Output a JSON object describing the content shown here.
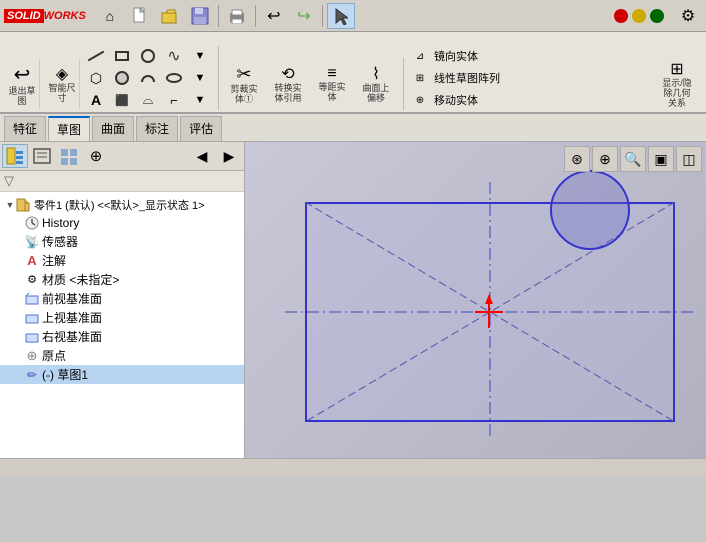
{
  "app": {
    "title": "SOLIDWORKS",
    "logo_solid": "SOLID",
    "logo_works": "WORKS"
  },
  "topbar": {
    "buttons": [
      "home",
      "new",
      "open",
      "save",
      "print",
      "undo",
      "redo",
      "cursor"
    ]
  },
  "ribbon": {
    "rows": [
      {
        "groups": [
          {
            "name": "exit-sketch",
            "buttons": [
              {
                "label": "退出草\n图",
                "icon": "↩",
                "large": true
              }
            ]
          },
          {
            "name": "smart-dim",
            "buttons": [
              {
                "label": "智能尺\n寸",
                "icon": "◈",
                "large": true
              }
            ]
          },
          {
            "name": "lines",
            "buttons": [
              {
                "label": "",
                "icon": "╲",
                "row": 0
              },
              {
                "label": "",
                "icon": "⌒",
                "row": 0
              },
              {
                "label": "",
                "icon": "∿",
                "row": 0
              },
              {
                "label": "",
                "icon": "⬚",
                "row": 0
              },
              {
                "label": "",
                "icon": "◯",
                "row": 1
              },
              {
                "label": "",
                "icon": "◔",
                "row": 1
              },
              {
                "label": "",
                "icon": "⬡",
                "row": 1
              },
              {
                "label": "",
                "icon": "∩",
                "row": 2
              },
              {
                "label": "",
                "icon": "□",
                "row": 2
              }
            ]
          }
        ]
      }
    ],
    "right_buttons": [
      {
        "label": "剪裁实\n体①",
        "icon": "✂"
      },
      {
        "label": "转换实\n体引用",
        "icon": "⬡"
      },
      {
        "label": "等距实\n体",
        "icon": "≡"
      },
      {
        "label": "曲面上\n偏移",
        "icon": "⌇"
      }
    ],
    "far_right": [
      {
        "label": "镜向实体",
        "icon": "⊿"
      },
      {
        "label": "线性草图阵列",
        "icon": "⊞"
      },
      {
        "label": "移动实体",
        "icon": "⊕"
      },
      {
        "label": "显示/隐除几何\n关系",
        "icon": "⊞"
      }
    ]
  },
  "ribbon_row2": {
    "groups": [
      [
        "╲",
        "⌒",
        "⌒",
        "∿",
        "⬛",
        "⬡",
        "○",
        "△",
        "◔",
        "⬡"
      ],
      [
        "✂",
        "⬡",
        "≡",
        "⌇"
      ]
    ]
  },
  "feature_tabs": [
    {
      "label": "特征",
      "active": false
    },
    {
      "label": "草图",
      "active": true
    },
    {
      "label": "曲面",
      "active": false
    },
    {
      "label": "标注",
      "active": false
    },
    {
      "label": "评估",
      "active": false
    }
  ],
  "panel_toolbar": {
    "buttons": [
      {
        "icon": "◧",
        "label": "feature-manager",
        "active": true
      },
      {
        "icon": "☰",
        "label": "property-manager",
        "active": false
      },
      {
        "icon": "⊡",
        "label": "config-manager",
        "active": false
      },
      {
        "icon": "⊕",
        "label": "dim-expert",
        "active": false
      }
    ]
  },
  "feature_tree": {
    "root_label": "零件1 (默认) <<默认>_显示状态 1>",
    "items": [
      {
        "id": "history",
        "label": "History",
        "icon": "📋",
        "indent": 1,
        "color": "#333"
      },
      {
        "id": "sensor",
        "label": "传感器",
        "icon": "📡",
        "indent": 1,
        "color": "#333"
      },
      {
        "id": "annotation",
        "label": "注解",
        "icon": "A",
        "indent": 1,
        "color": "#333"
      },
      {
        "id": "material",
        "label": "材质 <未指定>",
        "icon": "⚙",
        "indent": 1,
        "color": "#333"
      },
      {
        "id": "front-plane",
        "label": "前视基准面",
        "icon": "▭",
        "indent": 1,
        "color": "#333"
      },
      {
        "id": "top-plane",
        "label": "上视基准面",
        "icon": "▭",
        "indent": 1,
        "color": "#333"
      },
      {
        "id": "right-plane",
        "label": "右视基准面",
        "icon": "▭",
        "indent": 1,
        "color": "#333"
      },
      {
        "id": "origin",
        "label": "原点",
        "icon": "⊕",
        "indent": 1,
        "color": "#333"
      },
      {
        "id": "sketch1",
        "label": "(-) 草图1",
        "icon": "✏",
        "indent": 1,
        "color": "#333"
      }
    ]
  },
  "viewport": {
    "background": "#b8b8c8"
  },
  "statusbar": {
    "text": ""
  },
  "colors": {
    "accent_blue": "#0066cc",
    "sketch_blue": "#3333cc",
    "background_panel": "#f0ede8",
    "ribbon_bg": "#e8e4dc"
  }
}
